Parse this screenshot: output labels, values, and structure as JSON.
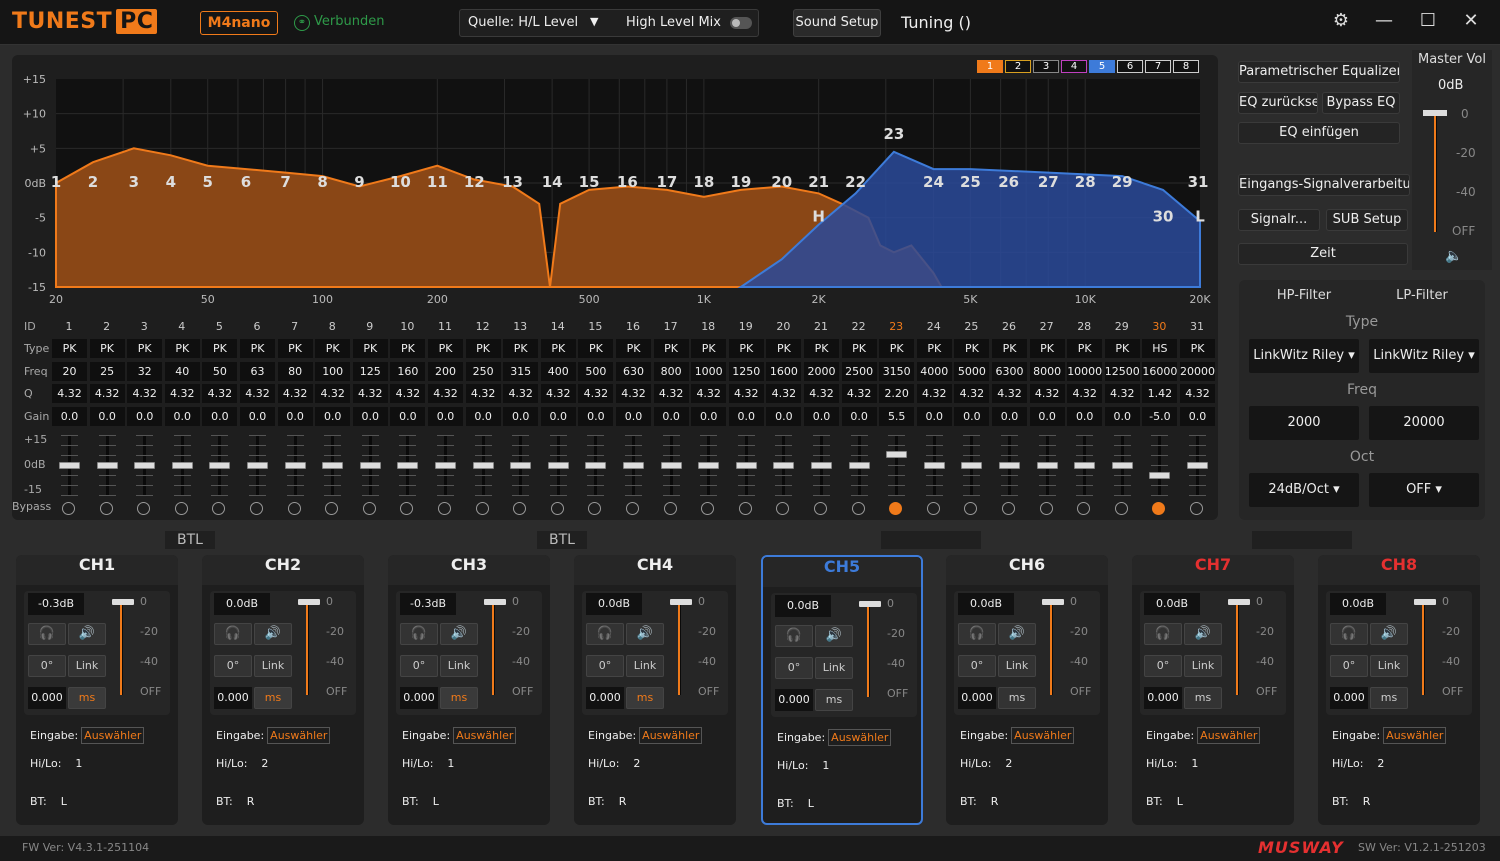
{
  "title_bar": {
    "logo": "TUNEST",
    "logo_badge": "PC",
    "model": "M4nano",
    "connection": "Verbunden",
    "source": "Quelle: H/L Level",
    "high_level_mix": "High Level Mix",
    "sound_setup": "Sound Setup",
    "tuning": "Tuning ()"
  },
  "graph": {
    "y_labels": [
      "+15",
      "+10",
      "+5",
      "0dB",
      "-5",
      "-10",
      "-15"
    ],
    "x_labels": [
      "20",
      "50",
      "100",
      "200",
      "500",
      "1K",
      "2K",
      "5K",
      "10K",
      "20K"
    ],
    "band_tabs": [
      {
        "label": "1",
        "color": "#f07a1a",
        "active": true
      },
      {
        "label": "2",
        "color": "#d8a020",
        "active": false
      },
      {
        "label": "3",
        "color": "#888888",
        "active": false
      },
      {
        "label": "4",
        "color": "#c040c0",
        "active": false
      },
      {
        "label": "5",
        "color": "#3d7bd9",
        "active": true
      },
      {
        "label": "6",
        "color": "#cccccc",
        "active": false
      },
      {
        "label": "7",
        "color": "#cccccc",
        "active": false
      },
      {
        "label": "8",
        "color": "#cccccc",
        "active": false
      }
    ],
    "marker_h": "H",
    "marker_l": "L"
  },
  "table": {
    "row_labels": {
      "id": "ID",
      "type": "Type",
      "freq": "Freq",
      "q": "Q",
      "gain": "Gain"
    },
    "ids": [
      "1",
      "2",
      "3",
      "4",
      "5",
      "6",
      "7",
      "8",
      "9",
      "10",
      "11",
      "12",
      "13",
      "14",
      "15",
      "16",
      "17",
      "18",
      "19",
      "20",
      "21",
      "22",
      "23",
      "24",
      "25",
      "26",
      "27",
      "28",
      "29",
      "30",
      "31"
    ],
    "types": [
      "PK",
      "PK",
      "PK",
      "PK",
      "PK",
      "PK",
      "PK",
      "PK",
      "PK",
      "PK",
      "PK",
      "PK",
      "PK",
      "PK",
      "PK",
      "PK",
      "PK",
      "PK",
      "PK",
      "PK",
      "PK",
      "PK",
      "PK",
      "PK",
      "PK",
      "PK",
      "PK",
      "PK",
      "PK",
      "HS",
      "PK"
    ],
    "freqs": [
      "20",
      "25",
      "32",
      "40",
      "50",
      "63",
      "80",
      "100",
      "125",
      "160",
      "200",
      "250",
      "315",
      "400",
      "500",
      "630",
      "800",
      "1000",
      "1250",
      "1600",
      "2000",
      "2500",
      "3150",
      "4000",
      "5000",
      "6300",
      "8000",
      "10000",
      "12500",
      "16000",
      "20000"
    ],
    "qs": [
      "4.32",
      "4.32",
      "4.32",
      "4.32",
      "4.32",
      "4.32",
      "4.32",
      "4.32",
      "4.32",
      "4.32",
      "4.32",
      "4.32",
      "4.32",
      "4.32",
      "4.32",
      "4.32",
      "4.32",
      "4.32",
      "4.32",
      "4.32",
      "4.32",
      "4.32",
      "2.20",
      "4.32",
      "4.32",
      "4.32",
      "4.32",
      "4.32",
      "4.32",
      "1.42",
      "4.32"
    ],
    "gains": [
      "0.0",
      "0.0",
      "0.0",
      "0.0",
      "0.0",
      "0.0",
      "0.0",
      "0.0",
      "0.0",
      "0.0",
      "0.0",
      "0.0",
      "0.0",
      "0.0",
      "0.0",
      "0.0",
      "0.0",
      "0.0",
      "0.0",
      "0.0",
      "0.0",
      "0.0",
      "5.5",
      "0.0",
      "0.0",
      "0.0",
      "0.0",
      "0.0",
      "0.0",
      "-5.0",
      "0.0"
    ],
    "slider_labels": [
      "+15",
      "0dB",
      "-15"
    ],
    "bypass_label": "Bypass",
    "bypass_active": [
      23,
      30
    ],
    "highlight_ids": [
      23,
      30
    ]
  },
  "right_panel": {
    "param_eq": "Parametrischer Equalizer",
    "reset": "EQ zurücksetzen",
    "bypass_eq": "Bypass EQ",
    "insert_eq": "EQ einfügen",
    "input_proc": "Eingangs-Signalverarbeitung",
    "signal": "Signalr...",
    "sub_setup": "SUB Setup",
    "time": "Zeit",
    "master_vol_label": "Master Vol",
    "master_vol_value": "0dB",
    "master_scale": [
      "0",
      "-20",
      "-40",
      "OFF"
    ]
  },
  "filter": {
    "hp": "HP-Filter",
    "lp": "LP-Filter",
    "type_label": "Type",
    "hp_type": "LinkWitz Riley",
    "lp_type": "LinkWitz Riley",
    "freq_label": "Freq",
    "hp_freq": "2000",
    "lp_freq": "20000",
    "oct_label": "Oct",
    "hp_oct": "24dB/Oct",
    "lp_oct": "OFF"
  },
  "btl_label": "BTL",
  "channels": [
    {
      "name": "CH1",
      "gain": "-0.3dB",
      "phase": "0°",
      "link": "Link",
      "delay": "0.000",
      "ms": "ms",
      "input_label": "Eingabe:",
      "input": "Auswähler",
      "hilo_label": "Hi/Lo:",
      "hilo": "1",
      "bt_label": "BT:",
      "bt": "L",
      "color": "#eeeeee",
      "ms_active": true,
      "selected": false
    },
    {
      "name": "CH2",
      "gain": "0.0dB",
      "phase": "0°",
      "link": "Link",
      "delay": "0.000",
      "ms": "ms",
      "input_label": "Eingabe:",
      "input": "Auswähler",
      "hilo_label": "Hi/Lo:",
      "hilo": "2",
      "bt_label": "BT:",
      "bt": "R",
      "color": "#eeeeee",
      "ms_active": true,
      "selected": false
    },
    {
      "name": "CH3",
      "gain": "-0.3dB",
      "phase": "0°",
      "link": "Link",
      "delay": "0.000",
      "ms": "ms",
      "input_label": "Eingabe:",
      "input": "Auswähler",
      "hilo_label": "Hi/Lo:",
      "hilo": "1",
      "bt_label": "BT:",
      "bt": "L",
      "color": "#eeeeee",
      "ms_active": true,
      "selected": false
    },
    {
      "name": "CH4",
      "gain": "0.0dB",
      "phase": "0°",
      "link": "Link",
      "delay": "0.000",
      "ms": "ms",
      "input_label": "Eingabe:",
      "input": "Auswähler",
      "hilo_label": "Hi/Lo:",
      "hilo": "2",
      "bt_label": "BT:",
      "bt": "R",
      "color": "#eeeeee",
      "ms_active": true,
      "selected": false
    },
    {
      "name": "CH5",
      "gain": "0.0dB",
      "phase": "0°",
      "link": "Link",
      "delay": "0.000",
      "ms": "ms",
      "input_label": "Eingabe:",
      "input": "Auswähler",
      "hilo_label": "Hi/Lo:",
      "hilo": "1",
      "bt_label": "BT:",
      "bt": "L",
      "color": "#3d7bd9",
      "ms_active": false,
      "selected": true
    },
    {
      "name": "CH6",
      "gain": "0.0dB",
      "phase": "0°",
      "link": "Link",
      "delay": "0.000",
      "ms": "ms",
      "input_label": "Eingabe:",
      "input": "Auswähler",
      "hilo_label": "Hi/Lo:",
      "hilo": "2",
      "bt_label": "BT:",
      "bt": "R",
      "color": "#eeeeee",
      "ms_active": false,
      "selected": false
    },
    {
      "name": "CH7",
      "gain": "0.0dB",
      "phase": "0°",
      "link": "Link",
      "delay": "0.000",
      "ms": "ms",
      "input_label": "Eingabe:",
      "input": "Auswähler",
      "hilo_label": "Hi/Lo:",
      "hilo": "1",
      "bt_label": "BT:",
      "bt": "L",
      "color": "#e53030",
      "ms_active": false,
      "selected": false
    },
    {
      "name": "CH8",
      "gain": "0.0dB",
      "phase": "0°",
      "link": "Link",
      "delay": "0.000",
      "ms": "ms",
      "input_label": "Eingabe:",
      "input": "Auswähler",
      "hilo_label": "Hi/Lo:",
      "hilo": "2",
      "bt_label": "BT:",
      "bt": "R",
      "color": "#e53030",
      "ms_active": false,
      "selected": false
    }
  ],
  "channel_scale": [
    "0",
    "-20",
    "-40",
    "OFF"
  ],
  "footer": {
    "fw": "FW Ver: V4.3.1-251104",
    "brand": "MUSWAY",
    "sw": "SW Ver: V1.2.1-251203"
  }
}
